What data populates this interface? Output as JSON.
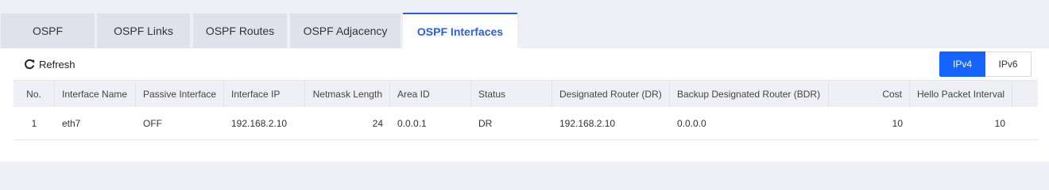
{
  "tabs": [
    "OSPF",
    "OSPF Links",
    "OSPF Routes",
    "OSPF Adjacency",
    "OSPF Interfaces"
  ],
  "active_tab": "OSPF Interfaces",
  "toolbar": {
    "refresh_label": "Refresh"
  },
  "ip_toggle": {
    "ipv4": "IPv4",
    "ipv6": "IPv6",
    "selected": "IPv4"
  },
  "colors": {
    "accent": "#1564ff",
    "tab_active": "#2b5fd9"
  },
  "table": {
    "columns": [
      "No.",
      "Interface Name",
      "Passive Interface",
      "Interface IP",
      "Netmask Length",
      "Area ID",
      "Status",
      "Designated Router (DR)",
      "Backup Designated Router (BDR)",
      "Cost",
      "Hello Packet Interval"
    ],
    "rows": [
      [
        "1",
        "eth7",
        "OFF",
        "192.168.2.10",
        "24",
        "0.0.0.1",
        "DR",
        "192.168.2.10",
        "0.0.0.0",
        "10",
        "10"
      ]
    ]
  }
}
